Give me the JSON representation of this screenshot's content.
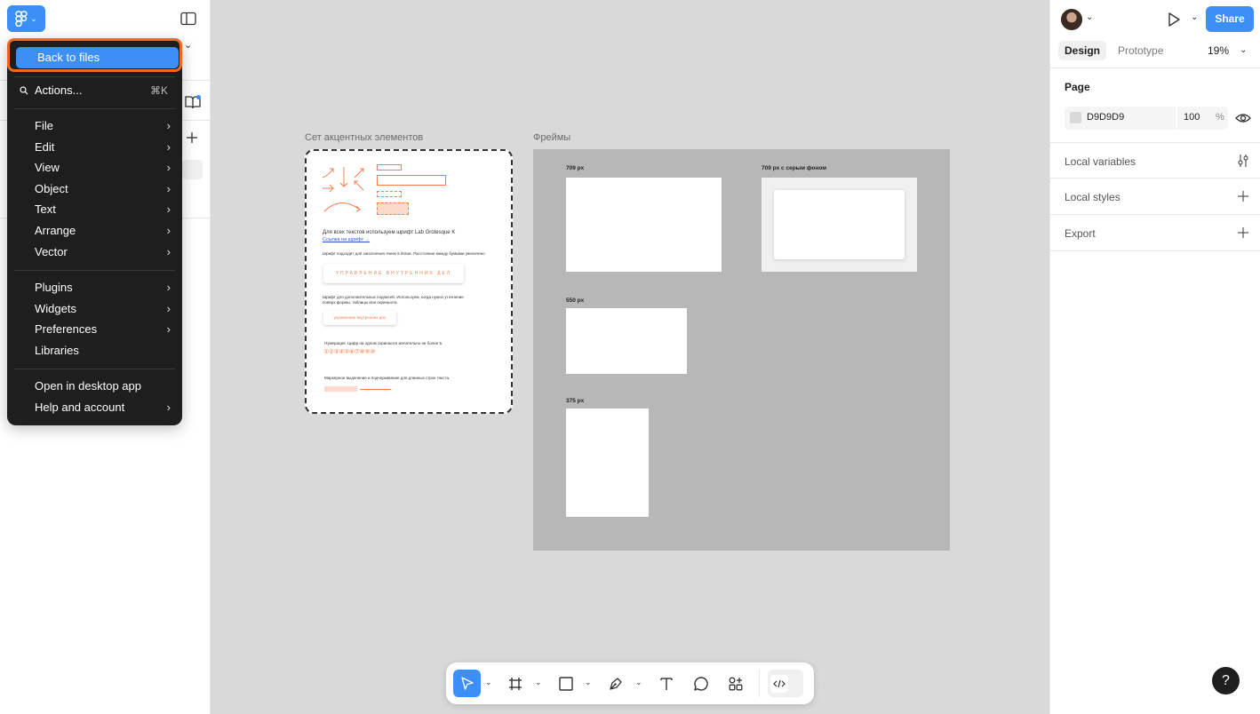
{
  "menu": {
    "back_label": "Back to files",
    "actions_label": "Actions...",
    "actions_shortcut": "⌘K",
    "group1": [
      "File",
      "Edit",
      "View",
      "Object",
      "Text",
      "Arrange",
      "Vector"
    ],
    "group2": [
      "Plugins",
      "Widgets",
      "Preferences",
      "Libraries"
    ],
    "group3": [
      "Open in desktop app",
      "Help and account"
    ]
  },
  "canvas": {
    "accent_frame_label": "Сет акцентных элементов",
    "frames_label": "Фреймы",
    "frame_709": "709 px",
    "frame_709_gray": "709 px с серым фоном",
    "frame_550": "550 px",
    "frame_375": "375 px",
    "accent": {
      "font_text": "Для всех текстов используем шрифт Lab Grotesque K",
      "font_link": "Ссылка на шрифт →",
      "font_note": "Шрифт подходит для заполнения ячеек 5 linkов. Расстояние между буквами увеличено",
      "button_caps": "УПРАВЛЕНИЕ ВНУТРЕННИХ ДЕЛ",
      "extra_note_1": "Шрифт для дополнительных подписей. Используем, когда нужно уточнение",
      "extra_note_2": "поверх формы, таблицы или скриншота.",
      "small_button": "управление внутренних дел",
      "numbering_note": "Нумерация. Цифр на одном скриншоте желательно не более 5.",
      "numbering": "①②③④⑤⑥⑦⑧⑨⑩",
      "marker_note": "Маркерное выделение и подчеркивание для длинных строк текста."
    }
  },
  "right_panel": {
    "tab_design": "Design",
    "tab_prototype": "Prototype",
    "zoom": "19%",
    "page_title": "Page",
    "page_color": "D9D9D9",
    "page_opacity": "100",
    "page_opacity_unit": "%",
    "local_variables": "Local variables",
    "local_styles": "Local styles",
    "export": "Export",
    "share": "Share",
    "help": "?"
  },
  "colors": {
    "accent": "#3b8ff6",
    "highlight": "#f2691e",
    "menu_bg": "#1e1e1e",
    "canvas_bg": "#d9d9d9"
  }
}
